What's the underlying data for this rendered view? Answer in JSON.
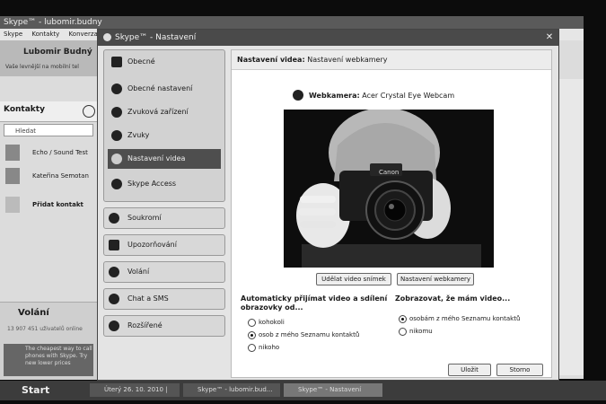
{
  "main_window": {
    "title": "Skype™ - lubomir.budny",
    "menu": [
      "Skype",
      "Kontakty",
      "Konverzace"
    ],
    "profile_name": "Lubomir Budný",
    "mood": "Vaše levnější na mobilní tel",
    "contacts_tab": "Kontakty",
    "search_placeholder": "Hledat",
    "contacts": [
      {
        "name": "Echo / Sound Test"
      },
      {
        "name": "Kateřina Semotan"
      },
      {
        "name": "Přidat kontakt"
      }
    ],
    "calls_title": "Volání",
    "calls_status": "13 907 451 uživatelů online",
    "ad_text": "The cheapest way to call phones with Skype. Try new lower prices"
  },
  "taskbar": {
    "start_label": "Start",
    "items": [
      "Úterý 26. 10. 2010 |",
      "Skype™ - lubomir.bud...",
      "Skype™ - Nastavení"
    ]
  },
  "dialog": {
    "title": "Skype™ - Nastavení",
    "nav": {
      "general_group": "Obecné",
      "general_items": [
        "Obecné nastavení",
        "Zvuková zařízení",
        "Zvuky",
        "Nastavení videa",
        "Skype Access"
      ],
      "selected_index": 3,
      "privacy": "Soukromí",
      "notifications": "Upozorňování",
      "calls": "Volání",
      "chat_sms": "Chat a SMS",
      "advanced": "Rozšířené"
    },
    "breadcrumb": {
      "section": "Nastavení videa:",
      "page": "Nastavení webkamery"
    },
    "webcam": {
      "label": "Webkamera:",
      "device": "Acer Crystal Eye Webcam",
      "camera_brand": "Canon"
    },
    "buttons": {
      "snapshot": "Udělat video snímek",
      "webcam_settings": "Nastavení webkamery",
      "save": "Uložit",
      "cancel": "Storno"
    },
    "auto_accept": {
      "title": "Automaticky přijímat video a sdílení obrazovky od...",
      "options": [
        "kohokoli",
        "osob z mého Seznamu kontaktů",
        "nikoho"
      ],
      "selected": 1
    },
    "show_video": {
      "title": "Zobrazovat, že mám video...",
      "options": [
        "osobám z mého Seznamu kontaktů",
        "nikomu"
      ],
      "selected": 0
    }
  }
}
